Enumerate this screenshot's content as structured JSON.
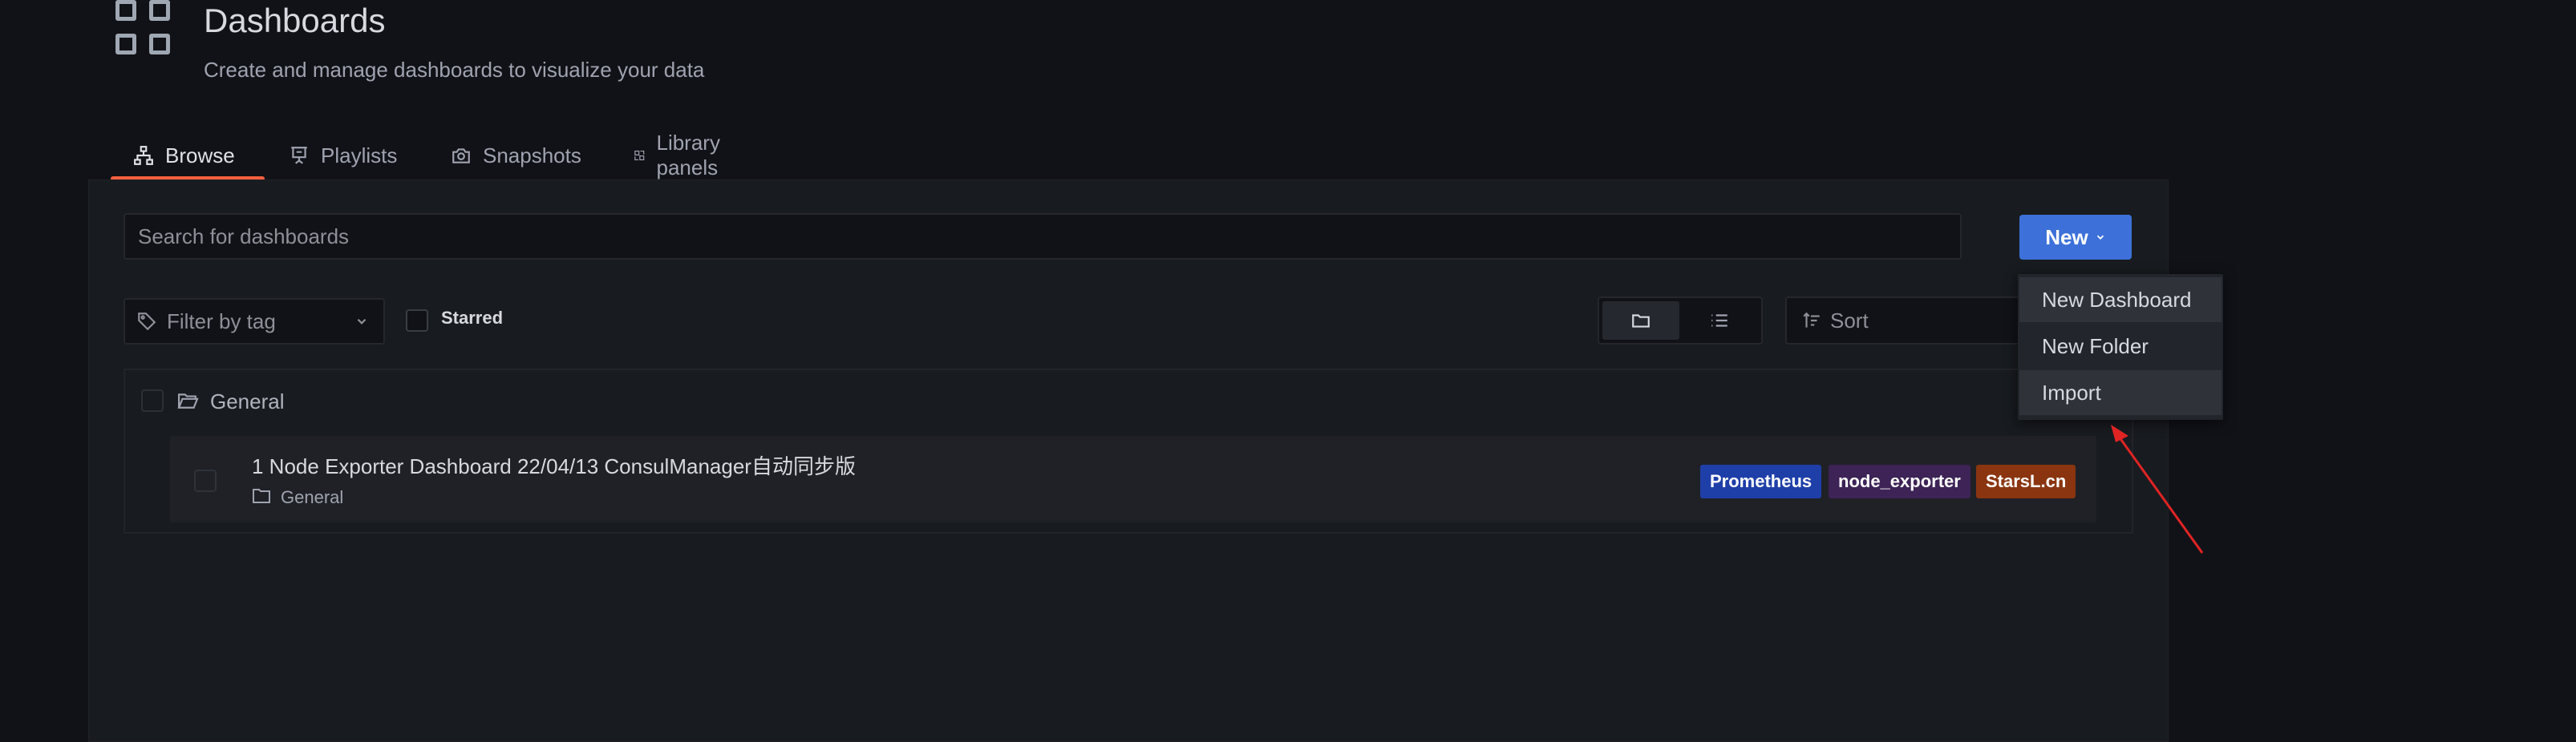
{
  "header": {
    "icon": "dashboards-grid-icon",
    "title": "Dashboards",
    "subtitle": "Create and manage dashboards to visualize your data"
  },
  "tabs": [
    {
      "label": "Browse",
      "icon": "sitemap-icon",
      "active": true
    },
    {
      "label": "Playlists",
      "icon": "presentation-icon",
      "active": false
    },
    {
      "label": "Snapshots",
      "icon": "camera-icon",
      "active": false
    },
    {
      "label": "Library panels",
      "icon": "library-panel-icon",
      "active": false
    }
  ],
  "toolbar": {
    "search_placeholder": "Search for dashboards",
    "new_label": "New",
    "filter_tag_placeholder": "Filter by tag",
    "starred_label": "Starred",
    "sort_placeholder": "Sort"
  },
  "new_menu": {
    "items": [
      "New Dashboard",
      "New Folder",
      "Import"
    ]
  },
  "folders": [
    {
      "name": "General",
      "dashboards": [
        {
          "title": "1 Node Exporter Dashboard 22/04/13 ConsulManager自动同步版",
          "folder": "General",
          "tags": [
            {
              "label": "Prometheus",
              "color": "#1f3fa8"
            },
            {
              "label": "node_exporter",
              "color": "#3d2356"
            },
            {
              "label": "StarsL.cn",
              "color": "#8a3510"
            }
          ]
        }
      ]
    }
  ],
  "colors": {
    "accent_tab": "#f55f3e",
    "primary_button": "#3d71d9",
    "annotation_arrow": "#e02424"
  }
}
